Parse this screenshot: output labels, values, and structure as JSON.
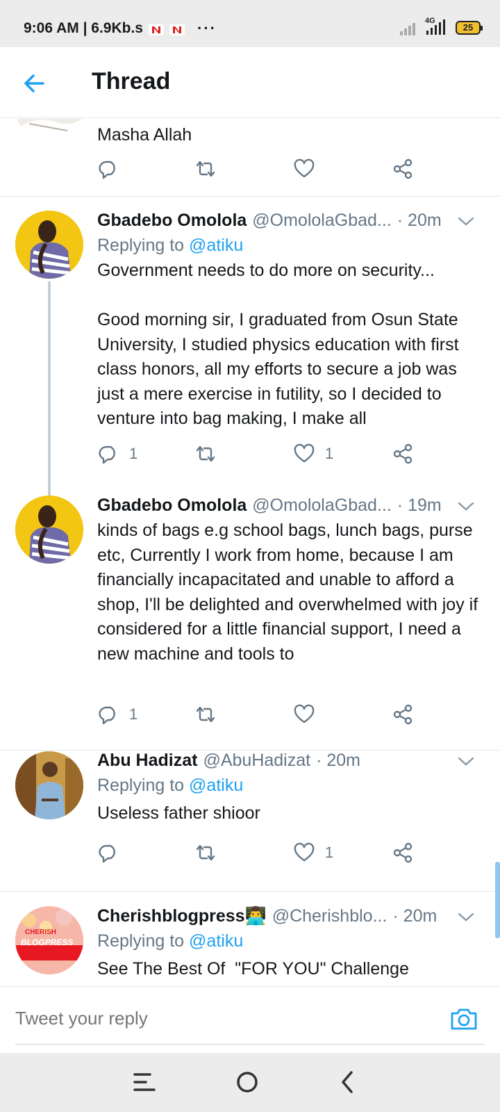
{
  "status_bar": {
    "time_speed": "9:06 AM | 6.9Kb.s",
    "dots": "···",
    "network": "4G",
    "battery": "25"
  },
  "header": {
    "title": "Thread"
  },
  "tweets": [
    {
      "text": "Masha Allah"
    },
    {
      "name": "Gbadebo Omolola",
      "handle": "@OmololaGbad...",
      "time": "· 20m",
      "replying_prefix": "Replying to ",
      "replying_to": "@atiku",
      "text": "Government needs to do more on security...\n\nGood morning sir, I graduated from Osun State University, I studied physics education with first class honors, all my efforts to secure a job was just a mere exercise in futility, so I decided to venture into bag making, I make all",
      "replies": "1",
      "likes": "1"
    },
    {
      "name": "Gbadebo Omolola",
      "handle": "@OmololaGbad...",
      "time": "· 19m",
      "text": "kinds of bags e.g school bags, lunch bags, purse etc, Currently I work from home, because I am financially incapacitated and unable to afford a shop, I'll be delighted and overwhelmed with joy if considered for a little financial support, I need a new machine and tools to",
      "replies": "1"
    },
    {
      "name": "Abu Hadizat",
      "handle": "@AbuHadizat",
      "time": "· 20m",
      "replying_prefix": "Replying to ",
      "replying_to": "@atiku",
      "text": "Useless father shioor",
      "likes": "1"
    },
    {
      "name": "Cherishblogpress👨‍💻",
      "handle": "@Cherishblo...",
      "time": "· 20m",
      "replying_prefix": "Replying to ",
      "replying_to": "@atiku",
      "text": "See The Best Of  \"FOR YOU\" Challenge",
      "avatar_text_top": "CHERISH",
      "avatar_text_bottom": "BLOGPRESS"
    }
  ],
  "reply_bar": {
    "placeholder": "Tweet your reply"
  },
  "colors": {
    "accent": "#1da1f2",
    "secondary_text": "#657786",
    "divider": "#e1e8ed"
  }
}
